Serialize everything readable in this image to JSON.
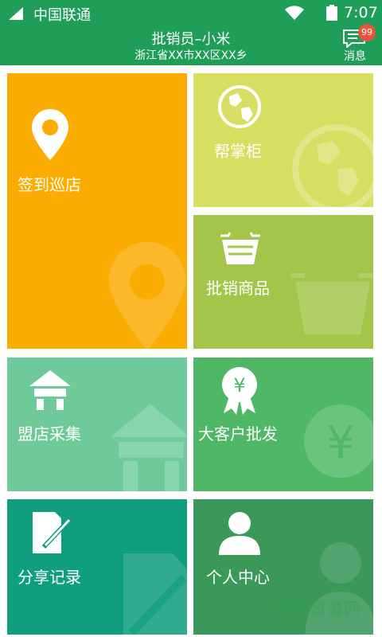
{
  "status_bar": {
    "carrier": "中国联通",
    "time": "7:07"
  },
  "header": {
    "title": "批销员–小米",
    "subtitle": "浙江省XX市XX区XX乡",
    "messages_label": "消息",
    "messages_badge": "99"
  },
  "tiles": [
    {
      "label": "签到巡店",
      "icon": "location-pin-icon",
      "color": "#fbac00"
    },
    {
      "label": "帮掌柜",
      "icon": "globe-icon",
      "color": "#d6df62"
    },
    {
      "label": "批销商品",
      "icon": "basket-icon",
      "color": "#a2c54a"
    },
    {
      "label": "盟店采集",
      "icon": "store-icon",
      "color": "#6ecb99"
    },
    {
      "label": "大客户批发",
      "icon": "yuan-badge-icon",
      "color": "#4eb867"
    },
    {
      "label": "分享记录",
      "icon": "document-pen-icon",
      "color": "#0f9e7e"
    },
    {
      "label": "个人中心",
      "icon": "person-icon",
      "color": "#3a9859"
    }
  ],
  "watermark": "绿色资源网"
}
